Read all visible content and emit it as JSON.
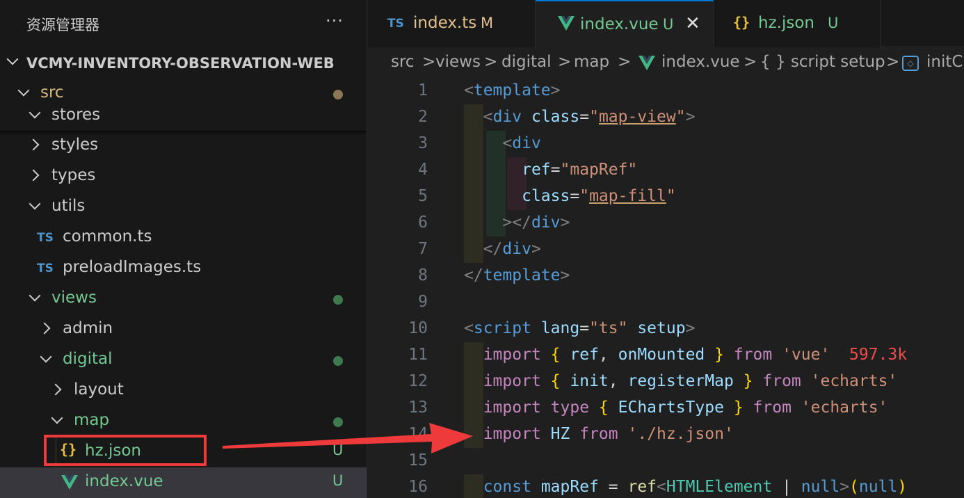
{
  "sidebar": {
    "title": "资源管理器",
    "more": "···",
    "root": "VCMY-INVENTORY-OBSERVATION-WEB",
    "items": [
      {
        "label": "src",
        "status": "dot",
        "status_color": "#8a7653",
        "label_color": "#d7ba7d"
      },
      {
        "label": "stores"
      },
      {
        "label": "styles"
      },
      {
        "label": "types"
      },
      {
        "label": "utils"
      },
      {
        "label": "common.ts",
        "icon": "TS"
      },
      {
        "label": "preloadImages.ts",
        "icon": "TS"
      },
      {
        "label": "views",
        "status": "dot",
        "status_color": "#3f7a4e",
        "label_color": "#73c991"
      },
      {
        "label": "admin"
      },
      {
        "label": "digital",
        "status": "dot",
        "status_color": "#3f7a4e",
        "label_color": "#73c991"
      },
      {
        "label": "layout"
      },
      {
        "label": "map",
        "status": "dot",
        "status_color": "#3f7a4e",
        "label_color": "#73c991"
      },
      {
        "label": "hz.json",
        "icon": "{}",
        "status": "U",
        "label_color": "#73c991"
      },
      {
        "label": "index.vue",
        "icon": "vue",
        "status": "U",
        "label_color": "#73c991"
      }
    ]
  },
  "tabs": [
    {
      "icon": "TS",
      "label": "index.ts",
      "status": "M",
      "label_color": "#e2c08d"
    },
    {
      "icon": "vue",
      "label": "index.vue",
      "status": "U",
      "label_color": "#73c991",
      "active": true
    },
    {
      "icon": "{}",
      "label": "hz.json",
      "status": "U",
      "label_color": "#73c991"
    }
  ],
  "breadcrumb": {
    "parts": [
      "src",
      "views",
      "digital",
      "map",
      "index.vue",
      "{ } script setup",
      "initC"
    ],
    "sep": ">"
  },
  "code": {
    "line_numbers": [
      "1",
      "2",
      "3",
      "4",
      "5",
      "6",
      "7",
      "8",
      "9",
      "10",
      "11",
      "12",
      "13",
      "14",
      "15",
      "16"
    ],
    "import_size": "597.3k"
  },
  "colors": {
    "accent": "#0078d4",
    "annotation": "#ee3a3a",
    "untracked": "#73c991",
    "modified": "#e2c08d"
  }
}
